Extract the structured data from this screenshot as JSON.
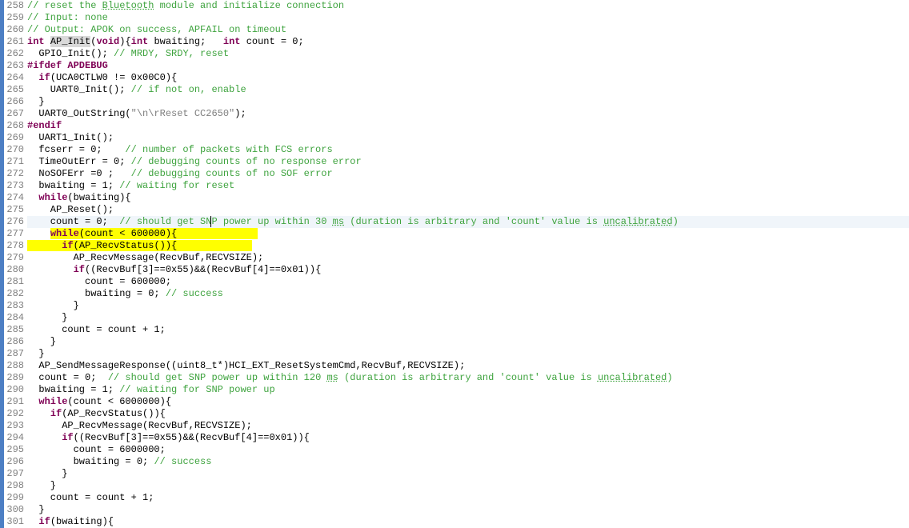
{
  "startLine": 258,
  "highlightLine": 276,
  "yellowLines": [
    277,
    278
  ],
  "lines": [
    {
      "n": 258,
      "segs": [
        {
          "cls": "c-comment",
          "t": "// reset the "
        },
        {
          "cls": "c-comment underdot",
          "t": "Bluetooth"
        },
        {
          "cls": "c-comment",
          "t": " module and initialize connection"
        }
      ]
    },
    {
      "n": 259,
      "segs": [
        {
          "cls": "c-comment",
          "t": "// Input: none"
        }
      ]
    },
    {
      "n": 260,
      "segs": [
        {
          "cls": "c-comment",
          "t": "// Output: APOK on success, APFAIL on timeout"
        }
      ]
    },
    {
      "n": 261,
      "segs": [
        {
          "cls": "c-type",
          "t": "int"
        },
        {
          "cls": "c-text",
          "t": " "
        },
        {
          "cls": "c-text funcname-hl",
          "t": "AP_Init"
        },
        {
          "cls": "c-text",
          "t": "("
        },
        {
          "cls": "c-type",
          "t": "void"
        },
        {
          "cls": "c-text",
          "t": "){"
        },
        {
          "cls": "c-type",
          "t": "int"
        },
        {
          "cls": "c-text",
          "t": " bwaiting;   "
        },
        {
          "cls": "c-type",
          "t": "int"
        },
        {
          "cls": "c-text",
          "t": " count = 0;"
        }
      ]
    },
    {
      "n": 262,
      "segs": [
        {
          "cls": "c-text",
          "t": "  GPIO_Init(); "
        },
        {
          "cls": "c-comment",
          "t": "// MRDY, SRDY, reset"
        }
      ]
    },
    {
      "n": 263,
      "segs": [
        {
          "cls": "c-pre",
          "t": "#ifdef APDEBUG"
        }
      ]
    },
    {
      "n": 264,
      "segs": [
        {
          "cls": "c-text",
          "t": "  "
        },
        {
          "cls": "c-keyword",
          "t": "if"
        },
        {
          "cls": "c-text",
          "t": "(UCA0CTLW0 != 0x00C0){"
        }
      ]
    },
    {
      "n": 265,
      "segs": [
        {
          "cls": "c-text",
          "t": "    UART0_Init(); "
        },
        {
          "cls": "c-comment",
          "t": "// if not on, enable"
        }
      ]
    },
    {
      "n": 266,
      "segs": [
        {
          "cls": "c-text",
          "t": "  }"
        }
      ]
    },
    {
      "n": 267,
      "segs": [
        {
          "cls": "c-text",
          "t": "  UART0_OutString("
        },
        {
          "cls": "c-string",
          "t": "\"\\n\\rReset CC2650\""
        },
        {
          "cls": "c-text",
          "t": ");"
        }
      ]
    },
    {
      "n": 268,
      "segs": [
        {
          "cls": "c-pre",
          "t": "#endif"
        }
      ]
    },
    {
      "n": 269,
      "segs": [
        {
          "cls": "c-text",
          "t": "  UART1_Init();"
        }
      ]
    },
    {
      "n": 270,
      "segs": [
        {
          "cls": "c-text",
          "t": "  fcserr = 0;    "
        },
        {
          "cls": "c-comment",
          "t": "// number of packets with FCS errors"
        }
      ]
    },
    {
      "n": 271,
      "segs": [
        {
          "cls": "c-text",
          "t": "  TimeOutErr = 0; "
        },
        {
          "cls": "c-comment",
          "t": "// debugging counts of no response error"
        }
      ]
    },
    {
      "n": 272,
      "segs": [
        {
          "cls": "c-text",
          "t": "  NoSOFErr =0 ;   "
        },
        {
          "cls": "c-comment",
          "t": "// debugging counts of no SOF error"
        }
      ]
    },
    {
      "n": 273,
      "segs": [
        {
          "cls": "c-text",
          "t": "  bwaiting = 1; "
        },
        {
          "cls": "c-comment",
          "t": "// waiting for reset"
        }
      ]
    },
    {
      "n": 274,
      "segs": [
        {
          "cls": "c-text",
          "t": "  "
        },
        {
          "cls": "c-keyword",
          "t": "while"
        },
        {
          "cls": "c-text",
          "t": "(bwaiting){"
        }
      ]
    },
    {
      "n": 275,
      "segs": [
        {
          "cls": "c-text",
          "t": "    AP_Reset();"
        }
      ]
    },
    {
      "n": 276,
      "segs": [
        {
          "cls": "c-text",
          "t": "    count = 0;  "
        },
        {
          "cls": "c-comment",
          "t": "// should get SN"
        },
        {
          "cls": "c-comment caret",
          "t": "P"
        },
        {
          "cls": "c-comment",
          "t": " power up within 30 "
        },
        {
          "cls": "c-comment underdot",
          "t": "ms"
        },
        {
          "cls": "c-comment",
          "t": " (duration is arbitrary and 'count' value is "
        },
        {
          "cls": "c-comment underdot",
          "t": "uncalibrated"
        },
        {
          "cls": "c-comment",
          "t": ")"
        }
      ]
    },
    {
      "n": 277,
      "segs": [
        {
          "cls": "c-text",
          "t": "    "
        },
        {
          "cls": "c-keyword yellow-bg",
          "t": "while"
        },
        {
          "cls": "c-text yellow-bg",
          "t": "(count < 600000){              "
        }
      ]
    },
    {
      "n": 278,
      "segs": [
        {
          "cls": "c-text yellow-bg",
          "t": "      "
        },
        {
          "cls": "c-keyword yellow-bg",
          "t": "if"
        },
        {
          "cls": "c-text yellow-bg",
          "t": "(AP_RecvStatus()){             "
        }
      ]
    },
    {
      "n": 279,
      "segs": [
        {
          "cls": "c-text",
          "t": "        AP_RecvMessage(RecvBuf,RECVSIZE);"
        }
      ]
    },
    {
      "n": 280,
      "segs": [
        {
          "cls": "c-text",
          "t": "        "
        },
        {
          "cls": "c-keyword",
          "t": "if"
        },
        {
          "cls": "c-text",
          "t": "((RecvBuf[3]==0x55)&&(RecvBuf[4]==0x01)){"
        }
      ]
    },
    {
      "n": 281,
      "segs": [
        {
          "cls": "c-text",
          "t": "          count = 600000;"
        }
      ]
    },
    {
      "n": 282,
      "segs": [
        {
          "cls": "c-text",
          "t": "          bwaiting = 0; "
        },
        {
          "cls": "c-comment",
          "t": "// success"
        }
      ]
    },
    {
      "n": 283,
      "segs": [
        {
          "cls": "c-text",
          "t": "        }"
        }
      ]
    },
    {
      "n": 284,
      "segs": [
        {
          "cls": "c-text",
          "t": "      }"
        }
      ]
    },
    {
      "n": 285,
      "segs": [
        {
          "cls": "c-text",
          "t": "      count = count + 1;"
        }
      ]
    },
    {
      "n": 286,
      "segs": [
        {
          "cls": "c-text",
          "t": "    }"
        }
      ]
    },
    {
      "n": 287,
      "segs": [
        {
          "cls": "c-text",
          "t": "  }"
        }
      ]
    },
    {
      "n": 288,
      "segs": [
        {
          "cls": "c-text",
          "t": "  AP_SendMessageResponse((uint8_t*)HCI_EXT_ResetSystemCmd,RecvBuf,RECVSIZE);"
        }
      ]
    },
    {
      "n": 289,
      "segs": [
        {
          "cls": "c-text",
          "t": "  count = 0;  "
        },
        {
          "cls": "c-comment",
          "t": "// should get SNP power up within 120 "
        },
        {
          "cls": "c-comment underdot",
          "t": "ms"
        },
        {
          "cls": "c-comment",
          "t": " (duration is arbitrary and 'count' value is "
        },
        {
          "cls": "c-comment underdot",
          "t": "uncalibrated"
        },
        {
          "cls": "c-comment",
          "t": ")"
        }
      ]
    },
    {
      "n": 290,
      "segs": [
        {
          "cls": "c-text",
          "t": "  bwaiting = 1; "
        },
        {
          "cls": "c-comment",
          "t": "// waiting for SNP power up"
        }
      ]
    },
    {
      "n": 291,
      "segs": [
        {
          "cls": "c-text",
          "t": "  "
        },
        {
          "cls": "c-keyword",
          "t": "while"
        },
        {
          "cls": "c-text",
          "t": "(count < 6000000){"
        }
      ]
    },
    {
      "n": 292,
      "segs": [
        {
          "cls": "c-text",
          "t": "    "
        },
        {
          "cls": "c-keyword",
          "t": "if"
        },
        {
          "cls": "c-text",
          "t": "(AP_RecvStatus()){"
        }
      ]
    },
    {
      "n": 293,
      "segs": [
        {
          "cls": "c-text",
          "t": "      AP_RecvMessage(RecvBuf,RECVSIZE);"
        }
      ]
    },
    {
      "n": 294,
      "segs": [
        {
          "cls": "c-text",
          "t": "      "
        },
        {
          "cls": "c-keyword",
          "t": "if"
        },
        {
          "cls": "c-text",
          "t": "((RecvBuf[3]==0x55)&&(RecvBuf[4]==0x01)){"
        }
      ]
    },
    {
      "n": 295,
      "segs": [
        {
          "cls": "c-text",
          "t": "        count = 6000000;"
        }
      ]
    },
    {
      "n": 296,
      "segs": [
        {
          "cls": "c-text",
          "t": "        bwaiting = 0; "
        },
        {
          "cls": "c-comment",
          "t": "// success"
        }
      ]
    },
    {
      "n": 297,
      "segs": [
        {
          "cls": "c-text",
          "t": "      }"
        }
      ]
    },
    {
      "n": 298,
      "segs": [
        {
          "cls": "c-text",
          "t": "    }"
        }
      ]
    },
    {
      "n": 299,
      "segs": [
        {
          "cls": "c-text",
          "t": "    count = count + 1;"
        }
      ]
    },
    {
      "n": 300,
      "segs": [
        {
          "cls": "c-text",
          "t": "  }"
        }
      ]
    },
    {
      "n": 301,
      "segs": [
        {
          "cls": "c-text",
          "t": "  "
        },
        {
          "cls": "c-keyword",
          "t": "if"
        },
        {
          "cls": "c-text",
          "t": "(bwaiting){"
        }
      ]
    }
  ]
}
